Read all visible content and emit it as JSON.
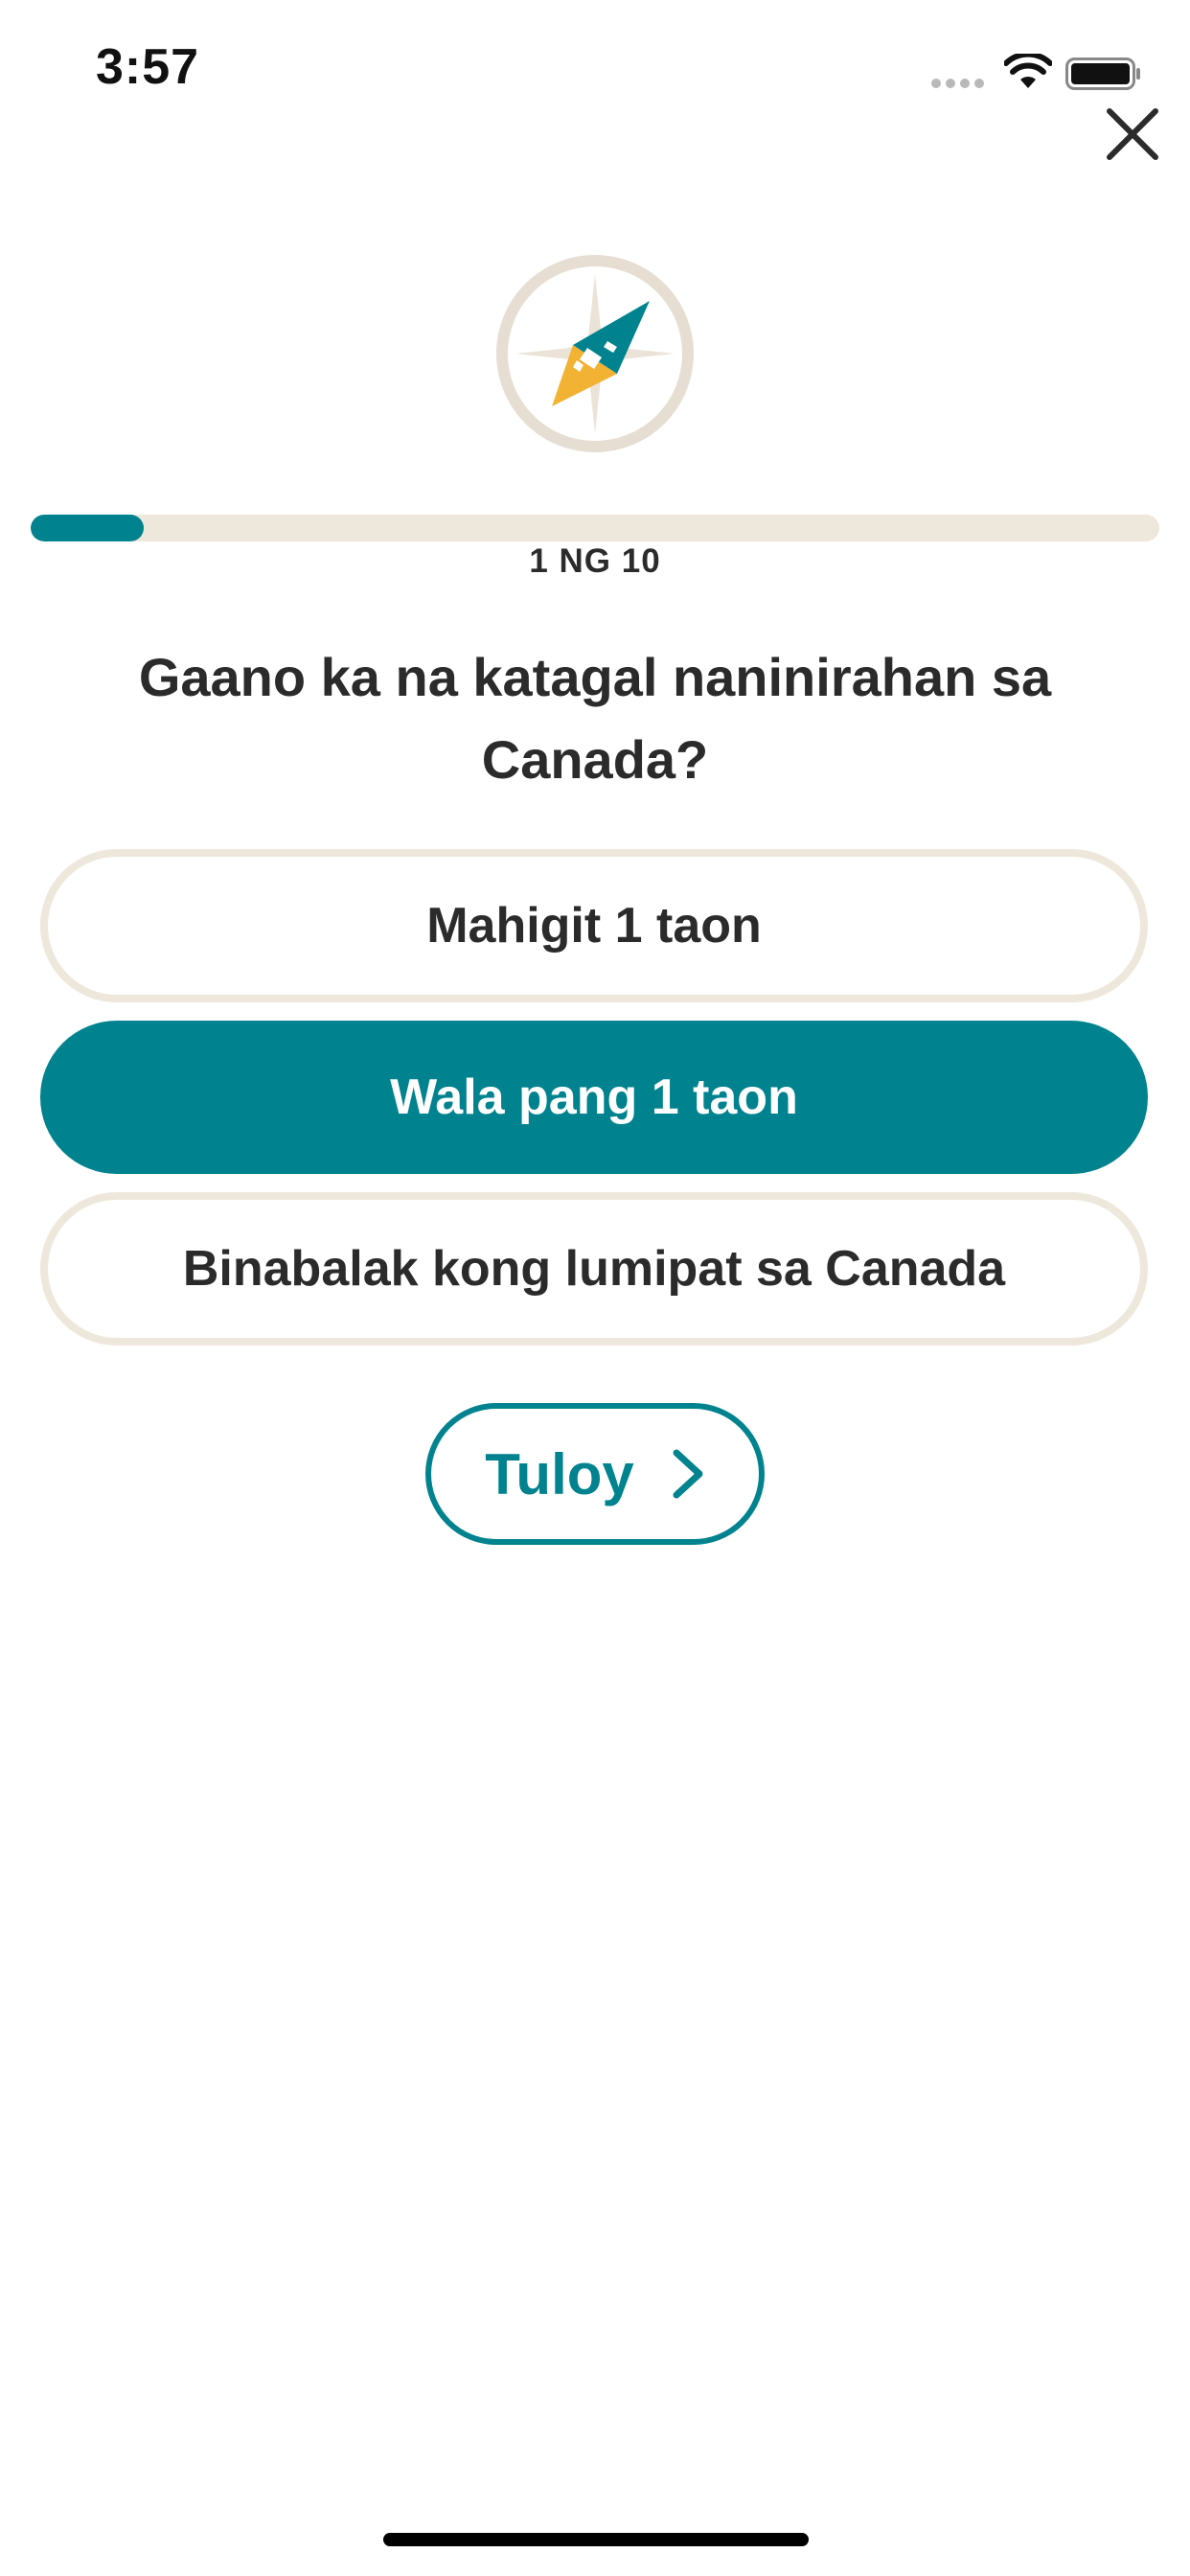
{
  "status_bar": {
    "time": "3:57",
    "icons": [
      "signal-dots-icon",
      "wifi-icon",
      "battery-icon"
    ]
  },
  "header": {
    "close_icon": "close-icon",
    "logo_icon": "compass-icon"
  },
  "progress": {
    "current": 1,
    "total": 10,
    "fraction": 0.1,
    "label": "1 NG 10"
  },
  "question": "Gaano ka na katagal naninirahan sa Canada?",
  "options": [
    {
      "label": "Mahigit 1 taon",
      "selected": false
    },
    {
      "label": "Wala pang 1 taon",
      "selected": true
    },
    {
      "label": "Binabalak kong lumipat sa Canada",
      "selected": false
    }
  ],
  "continue": {
    "label": "Tuloy",
    "icon": "chevron-right-icon"
  },
  "colors": {
    "accent": "#00838f",
    "track": "#eee7dc",
    "text": "#2b2b2b",
    "compass_yellow": "#f2b233",
    "compass_ring": "#e6ded3"
  }
}
